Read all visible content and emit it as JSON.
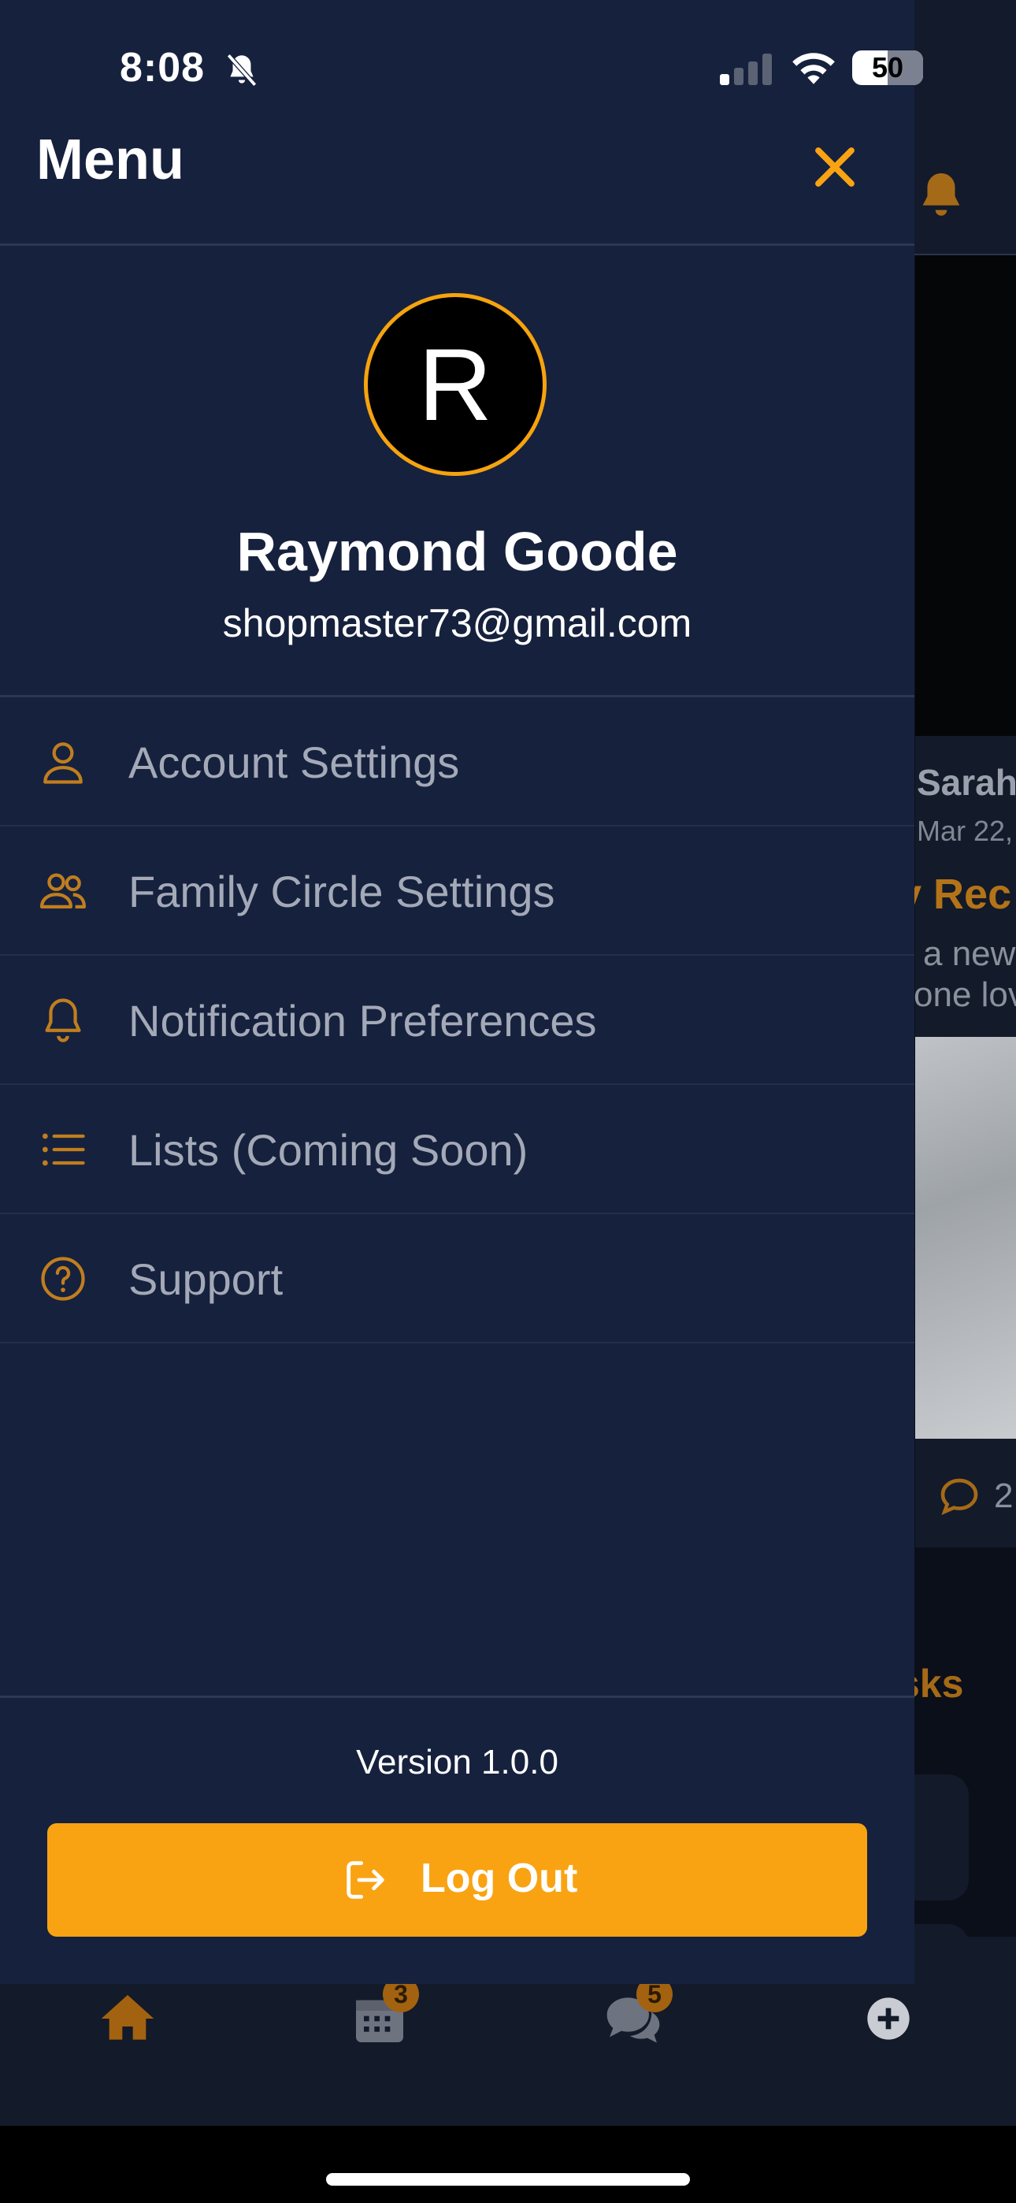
{
  "status_bar": {
    "time": "8:08",
    "battery": "50"
  },
  "drawer": {
    "title": "Menu",
    "profile": {
      "initial": "R",
      "name": "Raymond Goode",
      "email": "shopmaster73@gmail.com"
    },
    "menu_items": [
      {
        "label": "Account Settings",
        "icon": "user-icon"
      },
      {
        "label": "Family Circle Settings",
        "icon": "users-icon"
      },
      {
        "label": "Notification Preferences",
        "icon": "bell-icon"
      },
      {
        "label": "Lists (Coming Soon)",
        "icon": "list-icon"
      },
      {
        "label": "Support",
        "icon": "help-circle-icon"
      }
    ],
    "version": "Version 1.0.0",
    "logout_label": "Log Out"
  },
  "background": {
    "post_name": "Sarah",
    "post_date": "Mar 22,",
    "post_title": "v Rec",
    "post_line1": "a new",
    "post_line2": "one lov",
    "comment_count": "2",
    "tasks_label": "sks"
  },
  "tabbar": {
    "calendar_badge": "3",
    "chat_badge": "5"
  },
  "colors": {
    "accent": "#f9a313",
    "drawer_bg": "#16213d",
    "menu_text": "#a3a9b7"
  }
}
